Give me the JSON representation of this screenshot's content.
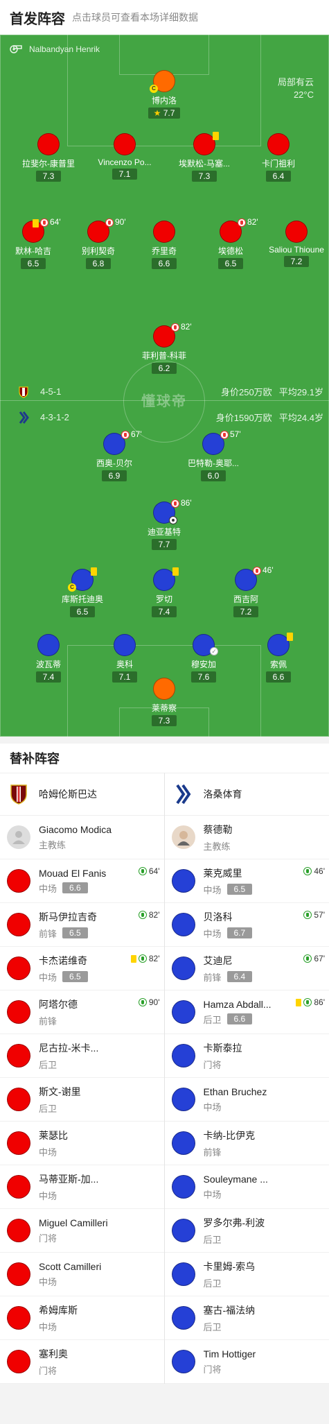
{
  "header": {
    "title": "首发阵容",
    "subtitle": "点击球员可查看本场详细数据"
  },
  "referee": "Nalbandyan Henrik",
  "weather": {
    "condition": "局部有云",
    "temperature": "22°C"
  },
  "home_team": {
    "formation": "4-5-1",
    "value": "身价250万欧",
    "avg_age": "平均29.1岁",
    "color": "#f00000"
  },
  "away_team": {
    "formation": "4-3-1-2",
    "value": "身价1590万欧",
    "avg_age": "平均24.4岁",
    "color": "#2540d6"
  },
  "watermark": "懂球帝",
  "pitch_players": [
    {
      "name": "博内洛",
      "rating": "7.7",
      "color": "orange",
      "star": true,
      "captain": true
    },
    {
      "name": "拉斐尔-康普里",
      "rating": "7.3",
      "color": "red"
    },
    {
      "name": "Vincenzo Po...",
      "rating": "7.1",
      "color": "red"
    },
    {
      "name": "埃默松-马塞...",
      "rating": "7.3",
      "color": "red",
      "card": true
    },
    {
      "name": "卡门祖利",
      "rating": "6.4",
      "color": "red"
    },
    {
      "name": "默林-哈吉",
      "rating": "6.5",
      "color": "red",
      "card": true,
      "sub": "64'"
    },
    {
      "name": "别利契奇",
      "rating": "6.8",
      "color": "red",
      "sub": "90'"
    },
    {
      "name": "乔里奇",
      "rating": "6.6",
      "color": "red"
    },
    {
      "name": "埃德松",
      "rating": "6.5",
      "color": "red",
      "sub": "82'"
    },
    {
      "name": "Saliou Thioune",
      "rating": "7.2",
      "color": "red"
    },
    {
      "name": "菲利普-科菲",
      "rating": "6.2",
      "color": "red",
      "sub": "82'"
    },
    {
      "name": "西奥-贝尔",
      "rating": "6.9",
      "color": "blue",
      "sub": "67'"
    },
    {
      "name": "巴特勒-奥耶...",
      "rating": "6.0",
      "color": "blue",
      "sub": "57'"
    },
    {
      "name": "迪亚基特",
      "rating": "7.7",
      "color": "blue",
      "sub": "86'",
      "goal": true
    },
    {
      "name": "库斯托迪奥",
      "rating": "6.5",
      "color": "blue",
      "card": true,
      "captain": true
    },
    {
      "name": "罗切",
      "rating": "7.4",
      "color": "blue",
      "card": true
    },
    {
      "name": "西吉阿",
      "rating": "7.2",
      "color": "blue",
      "sub": "46'"
    },
    {
      "name": "波瓦蒂",
      "rating": "7.4",
      "color": "blue"
    },
    {
      "name": "奥科",
      "rating": "7.1",
      "color": "blue"
    },
    {
      "name": "穆安加",
      "rating": "7.6",
      "color": "blue",
      "assist": true
    },
    {
      "name": "索佩",
      "rating": "6.6",
      "color": "blue",
      "card": true
    },
    {
      "name": "莱蒂察",
      "rating": "7.3",
      "color": "orange"
    }
  ],
  "subs": {
    "title": "替补阵容",
    "home": {
      "team_name": "哈姆伦斯巴达",
      "coach": {
        "name": "Giacomo Modica",
        "role": "主教练"
      },
      "players": [
        {
          "name": "Mouad El Fanis",
          "pos": "中场",
          "rating": "6.6",
          "minute": "64'"
        },
        {
          "name": "斯马伊拉吉奇",
          "pos": "前锋",
          "rating": "6.5",
          "minute": "82'"
        },
        {
          "name": "卡杰诺维奇",
          "pos": "中场",
          "rating": "6.5",
          "minute": "82'",
          "card": true
        },
        {
          "name": "阿塔尔德",
          "pos": "前锋",
          "minute": "90'"
        },
        {
          "name": "尼古拉-米卡...",
          "pos": "后卫"
        },
        {
          "name": "斯文-谢里",
          "pos": "后卫"
        },
        {
          "name": "莱瑟比",
          "pos": "中场"
        },
        {
          "name": "马蒂亚斯-加...",
          "pos": "中场"
        },
        {
          "name": "Miguel Camilleri",
          "pos": "门将"
        },
        {
          "name": "Scott Camilleri",
          "pos": "中场"
        },
        {
          "name": "希姆库斯",
          "pos": "中场"
        },
        {
          "name": "塞利奥",
          "pos": "门将"
        }
      ]
    },
    "away": {
      "team_name": "洛桑体育",
      "coach": {
        "name": "蔡德勒",
        "role": "主教练"
      },
      "players": [
        {
          "name": "莱克威里",
          "pos": "中场",
          "rating": "6.5",
          "minute": "46'"
        },
        {
          "name": "贝洛科",
          "pos": "中场",
          "rating": "6.7",
          "minute": "57'"
        },
        {
          "name": "艾迪尼",
          "pos": "前锋",
          "rating": "6.4",
          "minute": "67'"
        },
        {
          "name": "Hamza Abdall...",
          "pos": "后卫",
          "rating": "6.6",
          "minute": "86'",
          "card": true
        },
        {
          "name": "卡斯泰拉",
          "pos": "门将"
        },
        {
          "name": "Ethan Bruchez",
          "pos": "中场"
        },
        {
          "name": "卡纳-比伊克",
          "pos": "前锋"
        },
        {
          "name": "Souleymane ...",
          "pos": "中场"
        },
        {
          "name": "罗多尔弗-利波",
          "pos": "后卫"
        },
        {
          "name": "卡里姆-索乌",
          "pos": "后卫"
        },
        {
          "name": "塞古-福法纳",
          "pos": "后卫"
        },
        {
          "name": "Tim Hottiger",
          "pos": "门将"
        }
      ]
    }
  }
}
